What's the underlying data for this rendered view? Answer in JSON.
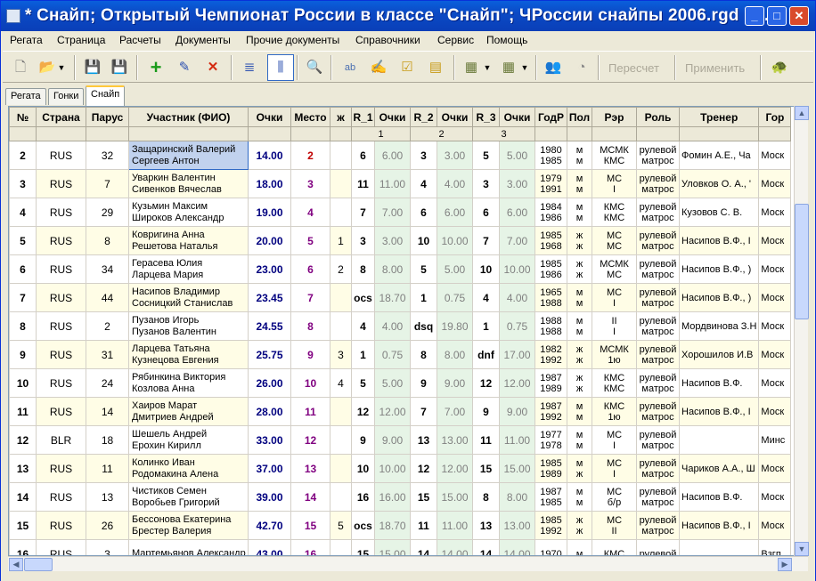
{
  "window": {
    "title": "* Снайп; Открытый Чемпионат России в классе \"Снайп\"; ЧРоссии снайпы 2006.rgd [9...",
    "minimize": "_",
    "maximize": "□",
    "close": "✕"
  },
  "menu": [
    "Регата",
    "Страница",
    "Расчеты",
    "Документы",
    "Прочие документы",
    "Справочники",
    "Сервис",
    "Помощь"
  ],
  "toolbar": {
    "recalc": "Пересчет",
    "apply": "Применить"
  },
  "tabs": [
    "Регата",
    "Гонки",
    "Снайп"
  ],
  "columns": [
    "№",
    "Страна",
    "Парус",
    "Участник (ФИО)",
    "Очки",
    "Место",
    "ж",
    "R_1",
    "Очки",
    "R_2",
    "Очки",
    "R_3",
    "Очки",
    "ГодР",
    "Пол",
    "Рэр",
    "Роль",
    "Тренер",
    "Гор"
  ],
  "race_numbers": [
    "1",
    "2",
    "3"
  ],
  "rows": [
    {
      "n": "2",
      "country": "RUS",
      "sail": "32",
      "name": "Защаринский Валерий\nСергеев Антон",
      "pts": "14.00",
      "place": "2",
      "w": "",
      "r1": "6",
      "p1": "6.00",
      "r2": "3",
      "p2": "3.00",
      "r3": "5",
      "p3": "5.00",
      "yr": "1980\n1985",
      "sex": "м\nм",
      "cat": "МСМК\nКМС",
      "role": "рулевой\nматрос",
      "coach": "Фомин А.Е., Ча",
      "city": "Моск"
    },
    {
      "n": "3",
      "country": "RUS",
      "sail": "7",
      "name": "Уваркин Валентин\nСивенков Вячеслав",
      "pts": "18.00",
      "place": "3",
      "w": "",
      "r1": "11",
      "p1": "11.00",
      "r2": "4",
      "p2": "4.00",
      "r3": "3",
      "p3": "3.00",
      "yr": "1979\n1991",
      "sex": "м\nм",
      "cat": "МС\nI",
      "role": "рулевой\nматрос",
      "coach": "Уловков О. А., '",
      "city": "Моск"
    },
    {
      "n": "4",
      "country": "RUS",
      "sail": "29",
      "name": "Кузьмин Максим\nШироков Александр",
      "pts": "19.00",
      "place": "4",
      "w": "",
      "r1": "7",
      "p1": "7.00",
      "r2": "6",
      "p2": "6.00",
      "r3": "6",
      "p3": "6.00",
      "yr": "1984\n1986",
      "sex": "м\nм",
      "cat": "КМС\nКМС",
      "role": "рулевой\nматрос",
      "coach": "Кузовов С. В.",
      "city": "Моск"
    },
    {
      "n": "5",
      "country": "RUS",
      "sail": "8",
      "name": "Ковригина Анна\nРешетова Наталья",
      "pts": "20.00",
      "place": "5",
      "w": "1",
      "r1": "3",
      "p1": "3.00",
      "r2": "10",
      "p2": "10.00",
      "r3": "7",
      "p3": "7.00",
      "yr": "1985\n1968",
      "sex": "ж\nж",
      "cat": "МС\nМС",
      "role": "рулевой\nматрос",
      "coach": "Насипов В.Ф., I",
      "city": "Моск"
    },
    {
      "n": "6",
      "country": "RUS",
      "sail": "34",
      "name": "Герасева Юлия\nЛарцева Мария",
      "pts": "23.00",
      "place": "6",
      "w": "2",
      "r1": "8",
      "p1": "8.00",
      "r2": "5",
      "p2": "5.00",
      "r3": "10",
      "p3": "10.00",
      "yr": "1985\n1986",
      "sex": "ж\nж",
      "cat": "МСМК\nМС",
      "role": "рулевой\nматрос",
      "coach": "Насипов В.Ф., )",
      "city": "Моск"
    },
    {
      "n": "7",
      "country": "RUS",
      "sail": "44",
      "name": "Насипов Владимир\nСосницкий Станислав",
      "pts": "23.45",
      "place": "7",
      "w": "",
      "r1": "ocs",
      "p1": "18.70",
      "r2": "1",
      "p2": "0.75",
      "r3": "4",
      "p3": "4.00",
      "yr": "1965\n1988",
      "sex": "м\nм",
      "cat": "МС\nI",
      "role": "рулевой\nматрос",
      "coach": "Насипов В.Ф., )",
      "city": "Моск"
    },
    {
      "n": "8",
      "country": "RUS",
      "sail": "2",
      "name": "Пузанов Игорь\nПузанов Валентин",
      "pts": "24.55",
      "place": "8",
      "w": "",
      "r1": "4",
      "p1": "4.00",
      "r2": "dsq",
      "p2": "19.80",
      "r3": "1",
      "p3": "0.75",
      "yr": "1988\n1988",
      "sex": "м\nм",
      "cat": "II\nI",
      "role": "рулевой\nматрос",
      "coach": "Мордвинова З.Н",
      "city": "Моск"
    },
    {
      "n": "9",
      "country": "RUS",
      "sail": "31",
      "name": "Ларцева Татьяна\nКузнецова Евгения",
      "pts": "25.75",
      "place": "9",
      "w": "3",
      "r1": "1",
      "p1": "0.75",
      "r2": "8",
      "p2": "8.00",
      "r3": "dnf",
      "p3": "17.00",
      "yr": "1982\n1992",
      "sex": "ж\nж",
      "cat": "МСМК\n1ю",
      "role": "рулевой\nматрос",
      "coach": "Хорошилов И.В",
      "city": "Моск"
    },
    {
      "n": "10",
      "country": "RUS",
      "sail": "24",
      "name": "Рябинкина Виктория\nКозлова Анна",
      "pts": "26.00",
      "place": "10",
      "w": "4",
      "r1": "5",
      "p1": "5.00",
      "r2": "9",
      "p2": "9.00",
      "r3": "12",
      "p3": "12.00",
      "yr": "1987\n1989",
      "sex": "ж\nж",
      "cat": "КМС\nКМС",
      "role": "рулевой\nматрос",
      "coach": "Насипов В.Ф.",
      "city": "Моск"
    },
    {
      "n": "11",
      "country": "RUS",
      "sail": "14",
      "name": "Хаиров Марат\nДмитриев Андрей",
      "pts": "28.00",
      "place": "11",
      "w": "",
      "r1": "12",
      "p1": "12.00",
      "r2": "7",
      "p2": "7.00",
      "r3": "9",
      "p3": "9.00",
      "yr": "1987\n1992",
      "sex": "м\nм",
      "cat": "КМС\n1ю",
      "role": "рулевой\nматрос",
      "coach": "Насипов В.Ф., I",
      "city": "Моск"
    },
    {
      "n": "12",
      "country": "BLR",
      "sail": "18",
      "name": "Шешель Андрей\nЕрохин Кирилл",
      "pts": "33.00",
      "place": "12",
      "w": "",
      "r1": "9",
      "p1": "9.00",
      "r2": "13",
      "p2": "13.00",
      "r3": "11",
      "p3": "11.00",
      "yr": "1977\n1978",
      "sex": "м\nм",
      "cat": "МС\nI",
      "role": "рулевой\nматрос",
      "coach": "",
      "city": "Минс"
    },
    {
      "n": "13",
      "country": "RUS",
      "sail": "11",
      "name": "Колинко Иван\nРодомакина Алена",
      "pts": "37.00",
      "place": "13",
      "w": "",
      "r1": "10",
      "p1": "10.00",
      "r2": "12",
      "p2": "12.00",
      "r3": "15",
      "p3": "15.00",
      "yr": "1985\n1989",
      "sex": "м\nж",
      "cat": "МС\nI",
      "role": "рулевой\nматрос",
      "coach": "Чариков А.А., Ш",
      "city": "Моск"
    },
    {
      "n": "14",
      "country": "RUS",
      "sail": "13",
      "name": "Чистиков Семен\nВоробьев Григорий",
      "pts": "39.00",
      "place": "14",
      "w": "",
      "r1": "16",
      "p1": "16.00",
      "r2": "15",
      "p2": "15.00",
      "r3": "8",
      "p3": "8.00",
      "yr": "1987\n1985",
      "sex": "м\nм",
      "cat": "МС\nб/р",
      "role": "рулевой\nматрос",
      "coach": "Насипов В.Ф.",
      "city": "Моск"
    },
    {
      "n": "15",
      "country": "RUS",
      "sail": "26",
      "name": "Бессонова Екатерина\nБрестер Валерия",
      "pts": "42.70",
      "place": "15",
      "w": "5",
      "r1": "ocs",
      "p1": "18.70",
      "r2": "11",
      "p2": "11.00",
      "r3": "13",
      "p3": "13.00",
      "yr": "1985\n1992",
      "sex": "ж\nж",
      "cat": "МС\nII",
      "role": "рулевой\nматрос",
      "coach": "Насипов В.Ф., I",
      "city": "Моск"
    },
    {
      "n": "16",
      "country": "RUS",
      "sail": "3",
      "name": "Мартемьянов Александр\n",
      "pts": "43.00",
      "place": "16",
      "w": "",
      "r1": "15",
      "p1": "15.00",
      "r2": "14",
      "p2": "14.00",
      "r3": "14",
      "p3": "14.00",
      "yr": "1970\n",
      "sex": "м\n",
      "cat": "КМС\n",
      "role": "рулевой\n",
      "coach": "",
      "city": "Взгп"
    }
  ]
}
